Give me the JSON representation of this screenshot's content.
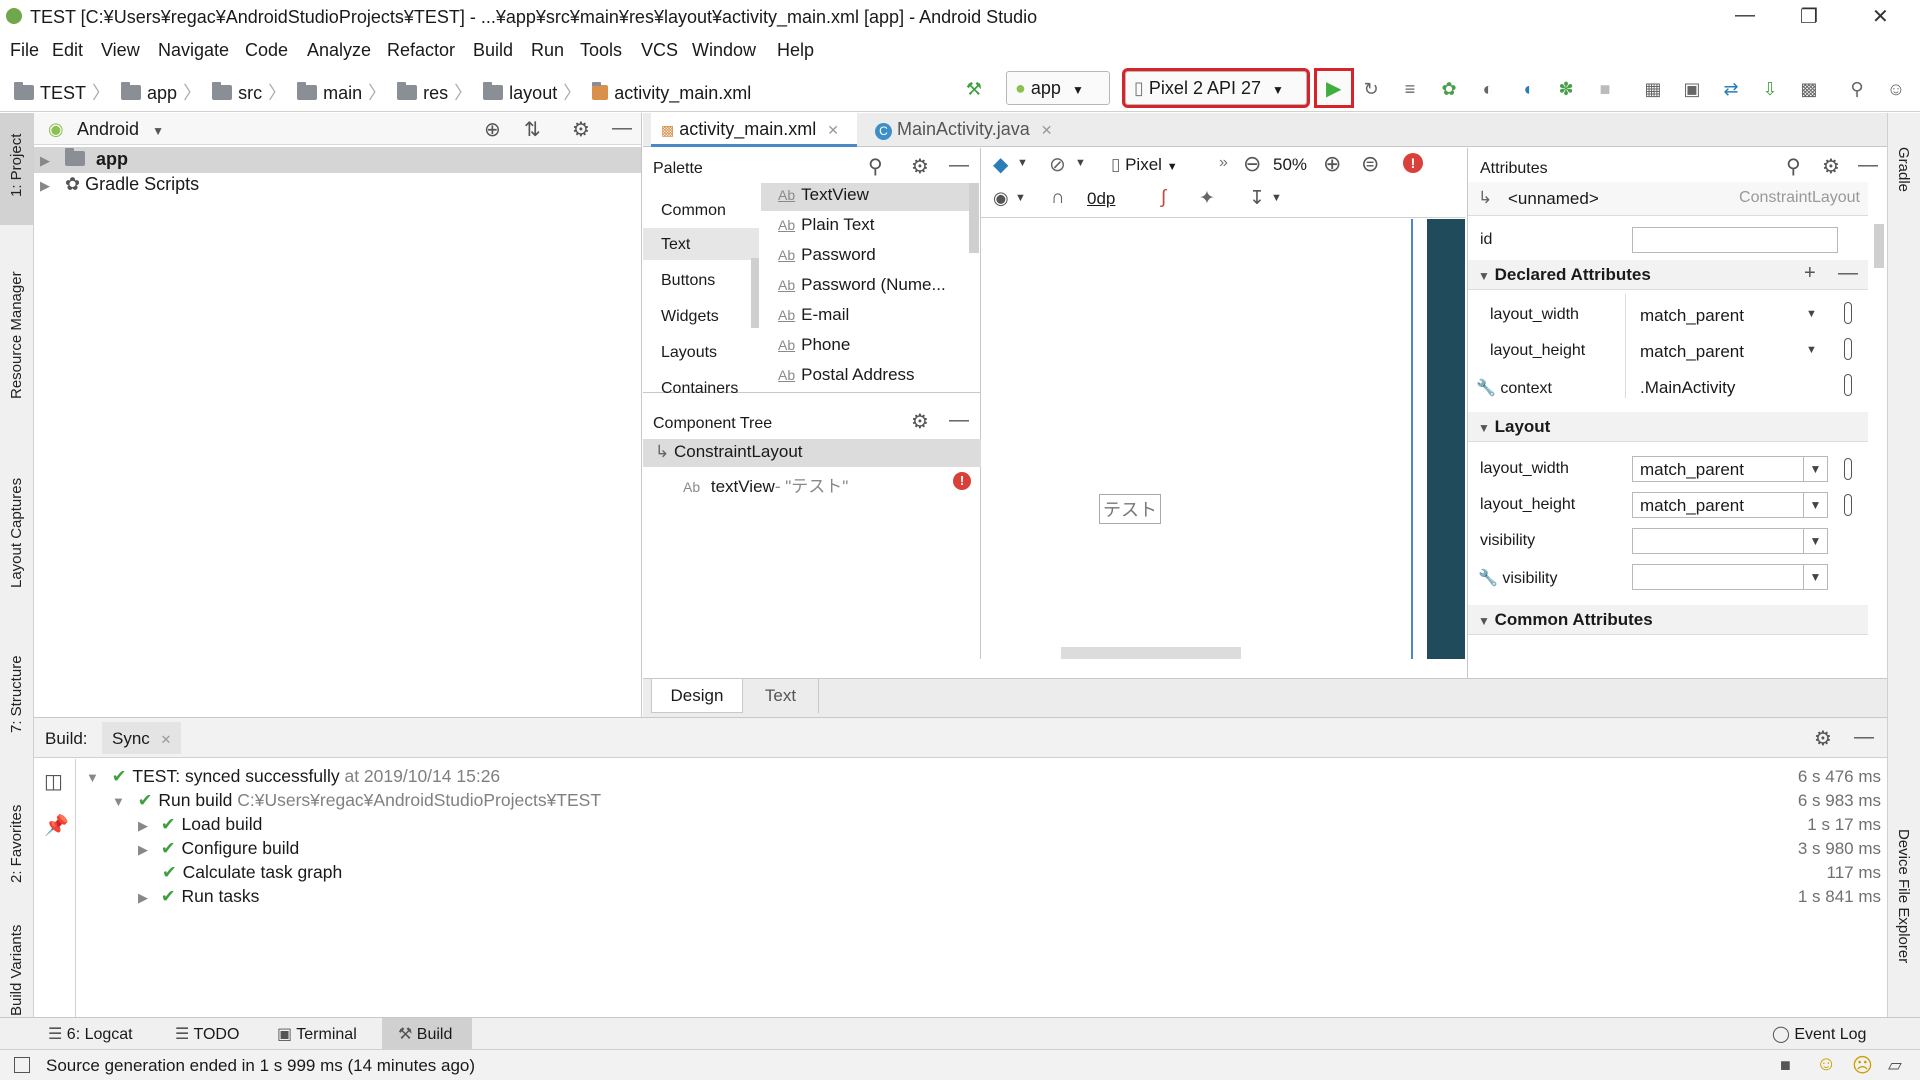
{
  "window": {
    "title": "TEST [C:¥Users¥regac¥AndroidStudioProjects¥TEST] - ...¥app¥src¥main¥res¥layout¥activity_main.xml [app] - Android Studio"
  },
  "menu": [
    "File",
    "Edit",
    "View",
    "Navigate",
    "Code",
    "Analyze",
    "Refactor",
    "Build",
    "Run",
    "Tools",
    "VCS",
    "Window",
    "Help"
  ],
  "breadcrumb": [
    "TEST",
    "app",
    "src",
    "main",
    "res",
    "layout",
    "activity_main.xml"
  ],
  "run_config": "app",
  "device": "Pixel 2 API 27",
  "left_tabs": [
    "1: Project",
    "Resource Manager",
    "Layout Captures",
    "7: Structure",
    "2: Favorites",
    "Build Variants"
  ],
  "right_tabs": [
    "Gradle",
    "Device File Explorer"
  ],
  "project": {
    "view": "Android",
    "items": [
      "app",
      "Gradle Scripts"
    ]
  },
  "editor_tabs": [
    "activity_main.xml",
    "MainActivity.java"
  ],
  "palette": {
    "title": "Palette",
    "categories": [
      "Common",
      "Text",
      "Buttons",
      "Widgets",
      "Layouts",
      "Containers"
    ],
    "items": [
      "TextView",
      "Plain Text",
      "Password",
      "Password (Nume...",
      "E-mail",
      "Phone",
      "Postal Address"
    ],
    "ab": "Ab"
  },
  "component_tree": {
    "title": "Component Tree",
    "root": "ConstraintLayout",
    "child": "textView",
    "child_text": "- \"テスト\""
  },
  "design_toolbar": {
    "device": "Pixel",
    "zoom": "50%",
    "margin": "0dp"
  },
  "canvas_text": "テスト",
  "design_tabs": [
    "Design",
    "Text"
  ],
  "attributes": {
    "title": "Attributes",
    "component_name": "<unnamed>",
    "component_type": "ConstraintLayout",
    "id_label": "id",
    "id_value": "",
    "declared_header": "Declared Attributes",
    "declared": [
      {
        "name": "layout_width",
        "value": "match_parent"
      },
      {
        "name": "layout_height",
        "value": "match_parent"
      },
      {
        "name": "context",
        "value": ".MainActivity"
      }
    ],
    "layout_header": "Layout",
    "layout": [
      {
        "name": "layout_width",
        "value": "match_parent"
      },
      {
        "name": "layout_height",
        "value": "match_parent"
      },
      {
        "name": "visibility",
        "value": ""
      },
      {
        "name": "visibility",
        "value": ""
      }
    ],
    "common_header": "Common Attributes"
  },
  "build": {
    "label": "Build:",
    "tab": "Sync",
    "lines": [
      {
        "text": "TEST:",
        "rest": " synced successfully",
        "extra": " at 2019/10/14 15:26",
        "time": "6 s 476 ms"
      },
      {
        "text": "Run build",
        "rest": "",
        "extra": " C:¥Users¥regac¥AndroidStudioProjects¥TEST",
        "time": "6 s 983 ms"
      },
      {
        "text": "Load build",
        "rest": "",
        "extra": "",
        "time": "1 s 17 ms"
      },
      {
        "text": "Configure build",
        "rest": "",
        "extra": "",
        "time": "3 s 980 ms"
      },
      {
        "text": "Calculate task graph",
        "rest": "",
        "extra": "",
        "time": "117 ms"
      },
      {
        "text": "Run tasks",
        "rest": "",
        "extra": "",
        "time": "1 s 841 ms"
      }
    ]
  },
  "bottom_tools": [
    "6: Logcat",
    "TODO",
    "Terminal",
    "Build"
  ],
  "event_log": "Event Log",
  "status": "Source generation ended in 1 s 999 ms (14 minutes ago)",
  "colors": {
    "accent": "#4a88c7",
    "highlight": "#d8232a",
    "check": "#3f9f3f",
    "android": "#8cc152"
  }
}
